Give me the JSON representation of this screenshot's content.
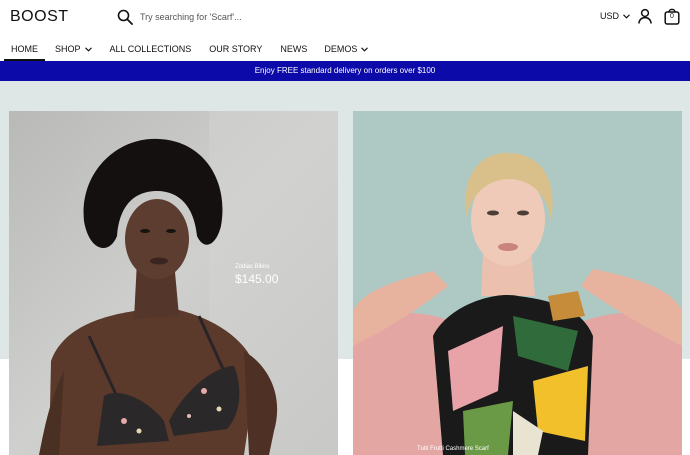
{
  "header": {
    "logo": "BOOST",
    "search_placeholder": "Try searching for 'Scarf'...",
    "currency": "USD",
    "cart_count": "0"
  },
  "nav": {
    "items": [
      {
        "label": "HOME",
        "active": true,
        "has_dropdown": false
      },
      {
        "label": "SHOP",
        "active": false,
        "has_dropdown": true
      },
      {
        "label": "ALL COLLECTIONS",
        "active": false,
        "has_dropdown": false
      },
      {
        "label": "OUR STORY",
        "active": false,
        "has_dropdown": false
      },
      {
        "label": "NEWS",
        "active": false,
        "has_dropdown": false
      },
      {
        "label": "DEMOS",
        "active": false,
        "has_dropdown": true
      }
    ]
  },
  "announcement": "Enjoy FREE standard delivery on orders over $100",
  "products": [
    {
      "name": "Zodiac Bikini",
      "price": "$145.00"
    },
    {
      "name": "Tutti Frutti Cashmere Scarf",
      "price": ""
    }
  ],
  "colors": {
    "announcement_bg": "#0c0aa9",
    "band_bg": "#dfe6e6",
    "text": "#111111"
  },
  "icons": [
    "search-icon",
    "chevron-down-icon",
    "account-icon",
    "shopping-bag-icon"
  ]
}
